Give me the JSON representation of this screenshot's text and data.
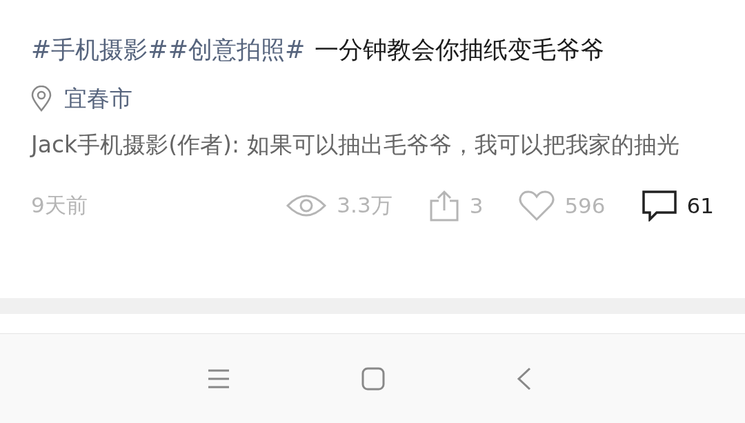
{
  "post": {
    "topics": [
      "#手机摄影#",
      "#创意拍照#"
    ],
    "title": "一分钟教会你抽纸变毛爷爷",
    "location": "宜春市",
    "comment": "Jack手机摄影(作者): 如果可以抽出毛爷爷，我可以把我家的抽光",
    "time": "9天前",
    "stats": [
      {
        "kind": "views",
        "count": "3.3万"
      },
      {
        "kind": "shares",
        "count": "3"
      },
      {
        "kind": "likes",
        "count": "596"
      },
      {
        "kind": "comments",
        "count": "61"
      }
    ]
  },
  "nav_bar": {
    "buttons": [
      {
        "kind": "menu"
      },
      {
        "kind": "home"
      },
      {
        "kind": "back"
      }
    ]
  }
}
